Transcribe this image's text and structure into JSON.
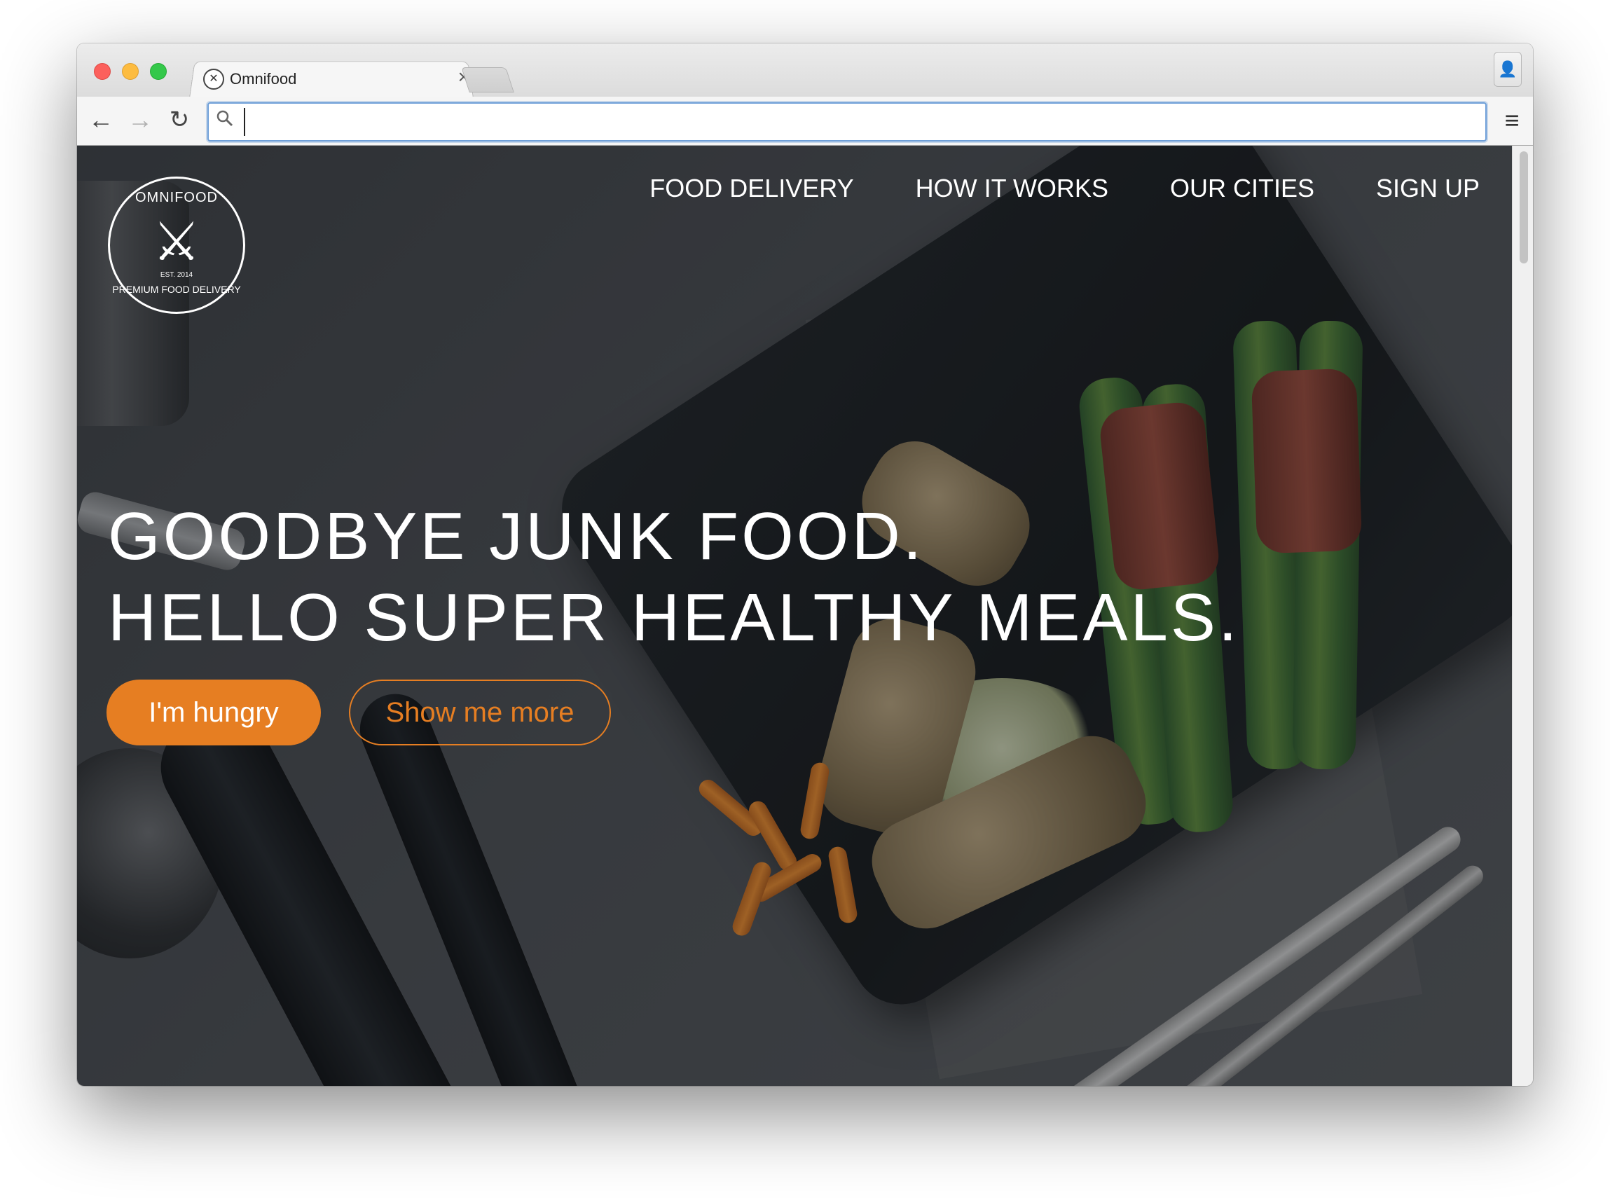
{
  "browser": {
    "tab_title": "Omnifood",
    "tab_close": "×",
    "favicon": "utensils-icon",
    "omnibox_value": "",
    "icons": {
      "back": "arrow-left-icon",
      "forward": "arrow-right-icon",
      "reload": "reload-icon",
      "search": "search-icon",
      "menu": "hamburger-menu-icon",
      "profile": "user-icon"
    }
  },
  "site": {
    "logo": {
      "top_text": "OMNIFOOD",
      "est_text": "EST. 2014",
      "bottom_text": "PREMIUM FOOD DELIVERY"
    },
    "nav": [
      "FOOD DELIVERY",
      "HOW IT WORKS",
      "OUR CITIES",
      "SIGN UP"
    ],
    "hero": {
      "line1": "GOODBYE JUNK FOOD.",
      "line2": "HELLO SUPER HEALTHY MEALS.",
      "primary_button": "I'm hungry",
      "secondary_button": "Show me more"
    }
  },
  "colors": {
    "accent": "#e67e22",
    "text": "#ffffff"
  }
}
